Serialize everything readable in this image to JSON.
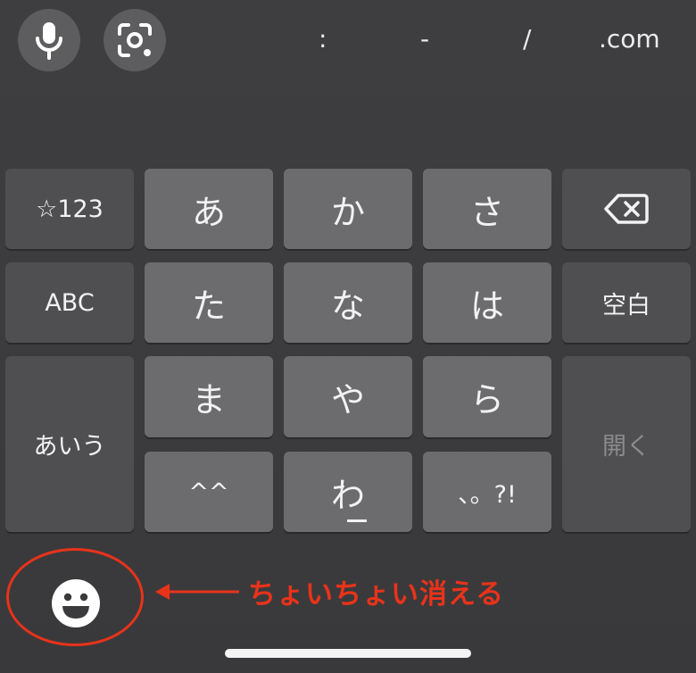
{
  "toolbar": {
    "mic_icon": "microphone-icon",
    "lens_icon": "camera-lens-icon",
    "symbols": [
      ":",
      "-",
      "/",
      ".com"
    ]
  },
  "keys": {
    "symbols_toggle": "☆123",
    "a": "あ",
    "ka": "か",
    "sa": "さ",
    "backspace_icon": "backspace-icon",
    "abc_toggle": "ABC",
    "ta": "た",
    "na": "な",
    "ha": "は",
    "space": "空白",
    "kana_toggle": "あいう",
    "ma": "ま",
    "ya": "や",
    "ra": "ら",
    "enter": "開く",
    "emoticon": "^^",
    "wa": "わ",
    "punct": "、。?!"
  },
  "bottom": {
    "emoji_icon": "smiley-face-icon"
  },
  "annotation": {
    "text": "ちょいちょい消える",
    "color": "#e8331a"
  },
  "colors": {
    "keyboard_bg": "#3b3b3d",
    "key_light": "#6c6c6f",
    "key_dark": "#4f4f52",
    "text": "#f2f2f2"
  }
}
